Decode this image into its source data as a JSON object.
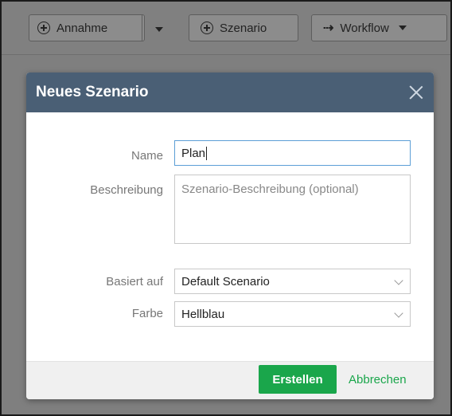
{
  "toolbar": {
    "annahme_label": "Annahme",
    "szenario_label": "Szenario",
    "workflow_label": "Workflow"
  },
  "modal": {
    "title": "Neues Szenario",
    "name_label": "Name",
    "name_value": "Plan",
    "description_label": "Beschreibung",
    "description_placeholder": "Szenario-Beschreibung (optional)",
    "based_on_label": "Basiert auf",
    "based_on_value": "Default Scenario",
    "color_label": "Farbe",
    "color_value": "Hellblau",
    "create_label": "Erstellen",
    "cancel_label": "Abbrechen"
  },
  "colors": {
    "header": "#4a5f75",
    "primary": "#1aa64b",
    "focus": "#5c9fd6"
  }
}
